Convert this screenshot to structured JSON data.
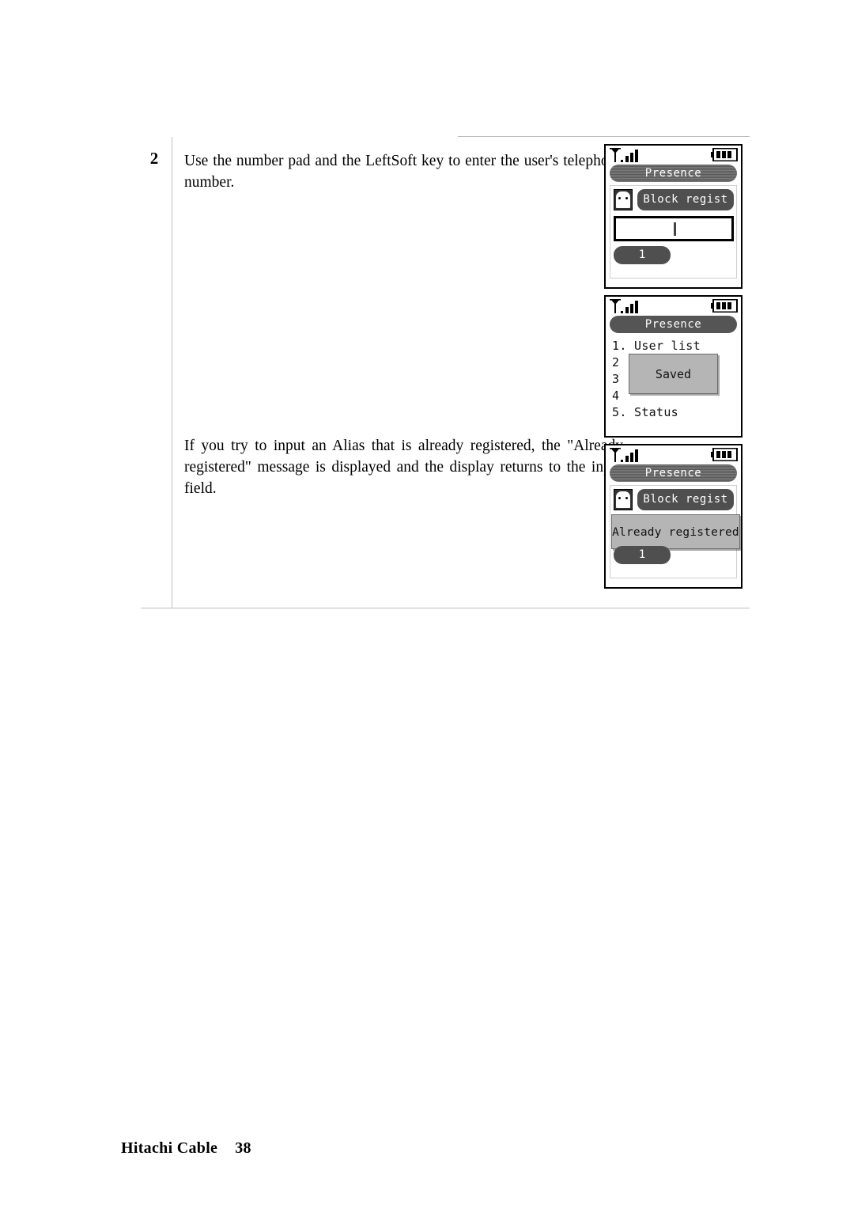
{
  "document": {
    "footer": {
      "publisher": "Hitachi Cable",
      "page_number": "38"
    }
  },
  "procedure": {
    "step": {
      "number": "2",
      "instruction": "Use the number pad and the LeftSoft key to enter the user's telephone number."
    },
    "note": "If you try to input an Alias that is already registered, the \"Already registered\" message is displayed and the display returns to the input field."
  },
  "screens": [
    {
      "id": "block-regist-input",
      "statusbar": {
        "signal_icon": "signal-antenna-icon",
        "signal_bars": 4,
        "battery_icon": "battery-icon",
        "battery_segments": 3
      },
      "title": "Presence",
      "avatar_icon": "user-avatar-icon",
      "field_label": "Block regist",
      "input_value": "",
      "softkey": "1"
    },
    {
      "id": "presence-menu-saved",
      "statusbar": {
        "signal_icon": "signal-antenna-icon",
        "signal_bars": 4,
        "battery_icon": "battery-icon",
        "battery_segments": 3
      },
      "title": "Presence",
      "menu_items": [
        "1. User list",
        "2",
        "3",
        "4",
        "5. Status"
      ],
      "dialog": "Saved"
    },
    {
      "id": "block-regist-already",
      "statusbar": {
        "signal_icon": "signal-antenna-icon",
        "signal_bars": 4,
        "battery_icon": "battery-icon",
        "battery_segments": 3
      },
      "title": "Presence",
      "avatar_icon": "user-avatar-icon",
      "field_label": "Block regist",
      "dialog": "Already registered",
      "softkey": "1"
    }
  ]
}
